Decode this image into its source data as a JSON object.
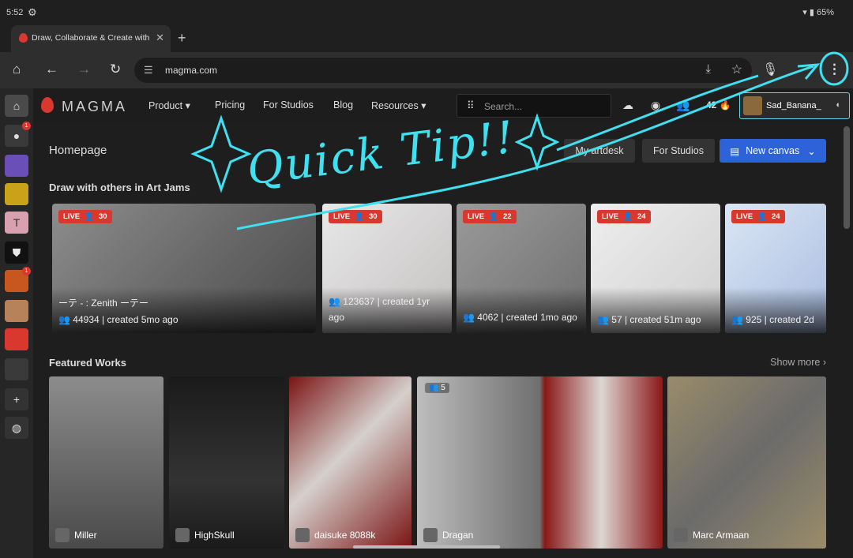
{
  "status_bar": {
    "time": "5:52",
    "battery": "65%"
  },
  "browser": {
    "tab_title": "Draw, Collaborate & Create with Artists",
    "url": "magma.com"
  },
  "sidebar": {
    "badges": [
      "1",
      "1"
    ],
    "text_item": "T"
  },
  "topnav": {
    "logo": "MAGMA",
    "links": [
      "Product",
      "Pricing",
      "For Studios",
      "Blog",
      "Resources"
    ],
    "search_placeholder": "Search...",
    "ink_count": "42",
    "username": "Sad_Banana_"
  },
  "header": {
    "title": "Homepage",
    "my_artdesk": "My artdesk",
    "for_studios": "For Studios",
    "new_canvas": "New canvas"
  },
  "art_jams": {
    "title": "Draw with others in Art Jams",
    "items": [
      {
        "live": "LIVE",
        "count": "30",
        "name": "ーテ - : Zenith ーテー",
        "stats": "44934 |  created 5mo ago"
      },
      {
        "live": "LIVE",
        "count": "30",
        "name": "",
        "stats": "123637 |  created 1yr ago"
      },
      {
        "live": "LIVE",
        "count": "22",
        "name": "",
        "stats": "4062 |  created 1mo ago"
      },
      {
        "live": "LIVE",
        "count": "24",
        "name": "",
        "stats": "57 |  created 51m ago"
      },
      {
        "live": "LIVE",
        "count": "24",
        "name": "",
        "stats": "925 |  created 2d"
      }
    ]
  },
  "featured": {
    "title": "Featured Works",
    "show_more": "Show more",
    "items": [
      {
        "author": "Miller"
      },
      {
        "author": "HighSkull"
      },
      {
        "author": "daisuke 8088k"
      },
      {
        "author": "Dragan",
        "layers": "5"
      },
      {
        "author": "Marc Armaan"
      }
    ]
  },
  "annotation": {
    "text": "Quick Tip!!",
    "color": "#3fe0ef"
  },
  "colors": {
    "accent_red": "#d9382f",
    "primary_blue": "#2e62d9",
    "highlight_cyan": "#5fd7e6"
  }
}
